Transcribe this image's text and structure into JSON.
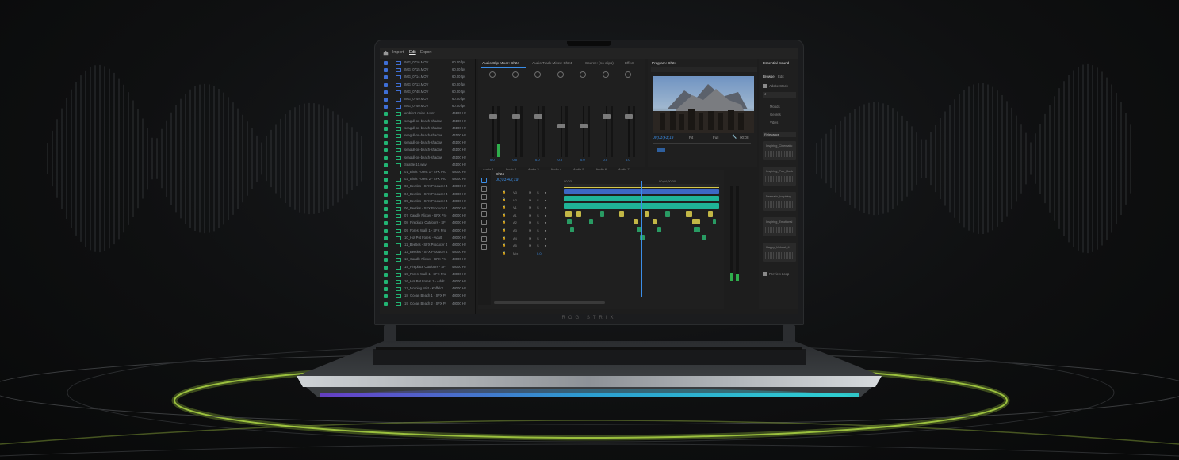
{
  "app": {
    "tabs": [
      "Import",
      "Edit",
      "Export"
    ],
    "active_tab": "Edit"
  },
  "project_items": [
    {
      "name": "IMG_0716.MOV",
      "rate": "60.00 fps",
      "color": "#3f6fd6",
      "kind": "video"
    },
    {
      "name": "IMG_0715.MOV",
      "rate": "60.00 fps",
      "color": "#3f6fd6",
      "kind": "video"
    },
    {
      "name": "IMG_0714.MOV",
      "rate": "60.00 fps",
      "color": "#3f6fd6",
      "kind": "video"
    },
    {
      "name": "IMG_0713.MOV",
      "rate": "60.00 fps",
      "color": "#3f6fd6",
      "kind": "video"
    },
    {
      "name": "IMG_0748.MOV",
      "rate": "60.00 fps",
      "color": "#3f6fd6",
      "kind": "video"
    },
    {
      "name": "IMG_0749.MOV",
      "rate": "60.00 fps",
      "color": "#3f6fd6",
      "kind": "video"
    },
    {
      "name": "IMG_0740.MOV",
      "rate": "60.00 fps",
      "color": "#3f6fd6",
      "kind": "video"
    },
    {
      "name": "ambient-noise-4.wav",
      "rate": "44100 Hz",
      "color": "#22b573",
      "kind": "audio"
    },
    {
      "name": "seagull-on-beach-shadow",
      "rate": "44100 Hz",
      "color": "#22b573",
      "kind": "audio"
    },
    {
      "name": "seagull-on-beach-shadow",
      "rate": "44100 Hz",
      "color": "#22b573",
      "kind": "audio"
    },
    {
      "name": "seagull-on-beach-shadow",
      "rate": "44100 Hz",
      "color": "#22b573",
      "kind": "audio"
    },
    {
      "name": "seagull-on-beach-shadow",
      "rate": "44100 Hz",
      "color": "#22b573",
      "kind": "audio"
    },
    {
      "name": "seagull-on-beach-shadow",
      "rate": "44100 Hz",
      "color": "#22b573",
      "kind": "audio"
    },
    {
      "name": "seagull-on-beach-shadow",
      "rate": "44100 Hz",
      "color": "#22b573",
      "kind": "audio"
    },
    {
      "name": "Seattle-10.wav",
      "rate": "44100 Hz",
      "color": "#22b573",
      "kind": "audio"
    },
    {
      "name": "01_Birds Forest 1 - SFX Pro",
      "rate": "48000 Hz",
      "color": "#22b573",
      "kind": "audio"
    },
    {
      "name": "02_Birds Forest 2 - SFX Pro",
      "rate": "48000 Hz",
      "color": "#22b573",
      "kind": "audio"
    },
    {
      "name": "03_Beetles - SFX Producer 4",
      "rate": "48000 Hz",
      "color": "#22b573",
      "kind": "audio"
    },
    {
      "name": "04_Beetles - SFX Producer 4",
      "rate": "48000 Hz",
      "color": "#22b573",
      "kind": "audio"
    },
    {
      "name": "05_Beetles - SFX Producer 4",
      "rate": "48000 Hz",
      "color": "#22b573",
      "kind": "audio"
    },
    {
      "name": "06_Beetles - SFX Producer 4",
      "rate": "48000 Hz",
      "color": "#22b573",
      "kind": "audio"
    },
    {
      "name": "07_Candle Flicker - SFX Pro",
      "rate": "48000 Hz",
      "color": "#22b573",
      "kind": "audio"
    },
    {
      "name": "08_Fireplace Outdoors - SF",
      "rate": "48000 Hz",
      "color": "#22b573",
      "kind": "audio"
    },
    {
      "name": "09_Forest Walk 1 - SFX Pro",
      "rate": "48000 Hz",
      "color": "#22b573",
      "kind": "audio"
    },
    {
      "name": "10_Hot Pot Forest - Adult",
      "rate": "48000 Hz",
      "color": "#22b573",
      "kind": "audio"
    },
    {
      "name": "11_Beetles - SFX Producer 4",
      "rate": "48000 Hz",
      "color": "#22b573",
      "kind": "audio"
    },
    {
      "name": "12_Beetles - SFX Producer 4",
      "rate": "48000 Hz",
      "color": "#22b573",
      "kind": "audio"
    },
    {
      "name": "13_Candle Flicker - SFX Pro",
      "rate": "48000 Hz",
      "color": "#22b573",
      "kind": "audio"
    },
    {
      "name": "14_Fireplace Outdoors - SF",
      "rate": "48000 Hz",
      "color": "#22b573",
      "kind": "audio"
    },
    {
      "name": "15_Forest Walk 1 - SFX Pro",
      "rate": "48000 Hz",
      "color": "#22b573",
      "kind": "audio"
    },
    {
      "name": "16_Hot Pot Forest 1 - Adult",
      "rate": "48000 Hz",
      "color": "#22b573",
      "kind": "audio"
    },
    {
      "name": "17_Morning Mist - Koffalot",
      "rate": "48000 Hz",
      "color": "#22b573",
      "kind": "audio"
    },
    {
      "name": "18_Ocean Beach 1 - SFX Pr",
      "rate": "48000 Hz",
      "color": "#22b573",
      "kind": "audio"
    },
    {
      "name": "19_Ocean Beach 2 - SFX Pr",
      "rate": "48000 Hz",
      "color": "#22b573",
      "kind": "audio"
    }
  ],
  "mixer": {
    "tabs": [
      "Audio Clip Mixer: Ch24",
      "Audio Track Mixer: Ch24",
      "Source: (no clips)",
      "Effect"
    ],
    "channels": [
      {
        "label": "A1",
        "name": "Audio 1",
        "value": "0.0",
        "level": 0.25,
        "fader": 0.15
      },
      {
        "label": "A2",
        "name": "Audio 2",
        "value": "0.0",
        "level": 0.0,
        "fader": 0.15
      },
      {
        "label": "A3",
        "name": "Audio 3",
        "value": "0.0",
        "level": 0.0,
        "fader": 0.15
      },
      {
        "label": "A4",
        "name": "Audio 4",
        "value": "0.0",
        "level": 0.0,
        "fader": 0.35
      },
      {
        "label": "A5",
        "name": "Audio 5",
        "value": "0.0",
        "level": 0.0,
        "fader": 0.35
      },
      {
        "label": "A6",
        "name": "Audio 6",
        "value": "0.0",
        "level": 0.0,
        "fader": 0.15
      },
      {
        "label": "A7",
        "name": "Audio 7",
        "value": "0.0",
        "level": 0.0,
        "fader": 0.15
      }
    ]
  },
  "program": {
    "tab": "Program: Ch24",
    "timecode": "00;03;43;19",
    "fit": "Fit",
    "quality": "Full",
    "end": "00:08"
  },
  "timeline": {
    "sequence": "Ch24",
    "timecode": "00;03;43;19",
    "ruler_labels": [
      "00;03",
      "00;04;00;00"
    ],
    "tracks": [
      "V3",
      "V2",
      "V1",
      "A1",
      "A2",
      "A3",
      "A4",
      "A5",
      "Mix"
    ],
    "mix_value": "0.0"
  },
  "essential_sound": {
    "title": "Essential Sound",
    "tabs": [
      "Browse",
      "Edit"
    ],
    "checkbox": "Adobe Stock",
    "categories": [
      "Moods",
      "Genres",
      "Vibes"
    ],
    "sort": "Relevance",
    "results": [
      "Inspiring_Cinematic",
      "Inspiring_Pop_Rock",
      "Dramatic_Inspiring",
      "Inspiring_Emotional",
      "Happy_Upbeat_4"
    ],
    "footer_checkbox": "Preview Loop"
  },
  "brand": "ROG STRIX",
  "colors": {
    "accent_blue": "#3b8ee8",
    "audio_green": "#22b573",
    "video_blue": "#3f6fd6",
    "timeline_teal": "#1fc3a5",
    "clip_yellow": "#d4c84a",
    "floor_glow": "#9acd32"
  }
}
